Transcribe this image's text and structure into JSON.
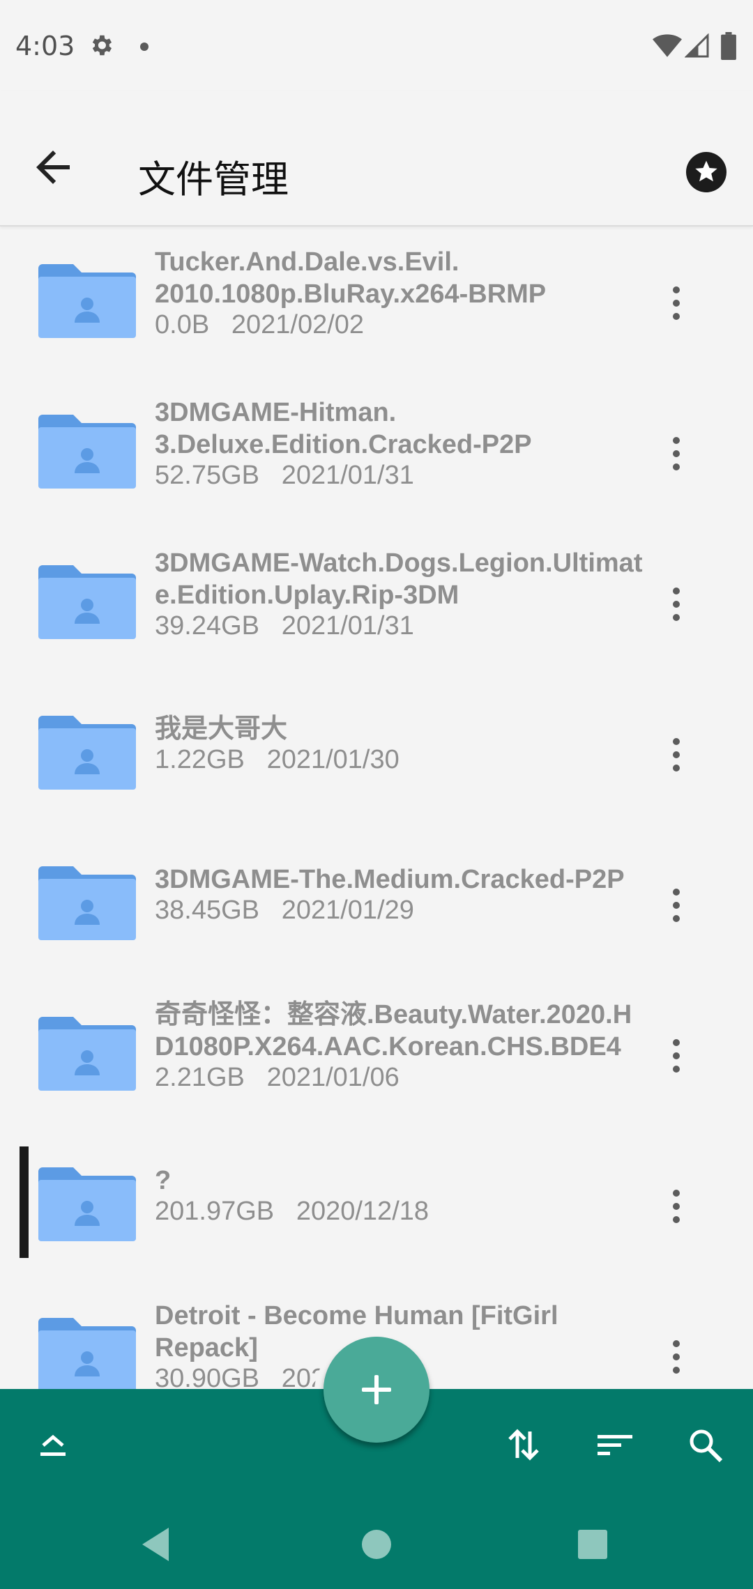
{
  "status_bar": {
    "time": "4:03",
    "icons": [
      "gear-icon",
      "notification-dot-icon",
      "wifi-icon",
      "cell-signal-icon",
      "battery-icon"
    ]
  },
  "app_bar": {
    "title": "文件管理",
    "back_icon": "arrow-left-icon",
    "action_icon": "star-circle-icon"
  },
  "files": [
    {
      "name": "Tucker.And.Dale.vs.Evil.\n2010.1080p.BluRay.x264-BRMP",
      "size": "0.0B",
      "date": "2021/02/02"
    },
    {
      "name": "3DMGAME-Hitman.\n3.Deluxe.Edition.Cracked-P2P",
      "size": "52.75GB",
      "date": "2021/01/31"
    },
    {
      "name": "3DMGAME-Watch.Dogs.Legion.Ultimat\ne.Edition.Uplay.Rip-3DM",
      "size": "39.24GB",
      "date": "2021/01/31"
    },
    {
      "name": "我是大哥大",
      "size": "1.22GB",
      "date": "2021/01/30"
    },
    {
      "name": "3DMGAME-The.Medium.Cracked-P2P",
      "size": "38.45GB",
      "date": "2021/01/29"
    },
    {
      "name": "奇奇怪怪：整容液.Beauty.Water.2020.H\nD1080P.X264.AAC.Korean.CHS.BDE4",
      "size": "2.21GB",
      "date": "2021/01/06"
    },
    {
      "name": "?",
      "size": "201.97GB",
      "date": "2020/12/18",
      "selected": true
    },
    {
      "name": "Detroit - Become Human [FitGirl\nRepack]",
      "size": "30.90GB",
      "date": "2021/01/01"
    }
  ],
  "bottom_toolbar": {
    "fab_icon": "plus-icon",
    "buttons": [
      "go-up-icon",
      "sort-order-icon",
      "sort-list-icon",
      "search-icon"
    ]
  },
  "nav_bar": {
    "buttons": [
      "back-triangle-icon",
      "home-circle-icon",
      "recents-square-icon"
    ]
  },
  "colors": {
    "accent": "#037a6a",
    "fab": "#4aaa98",
    "folder": "#89bcfa",
    "folder_dark": "#5c9be4"
  }
}
